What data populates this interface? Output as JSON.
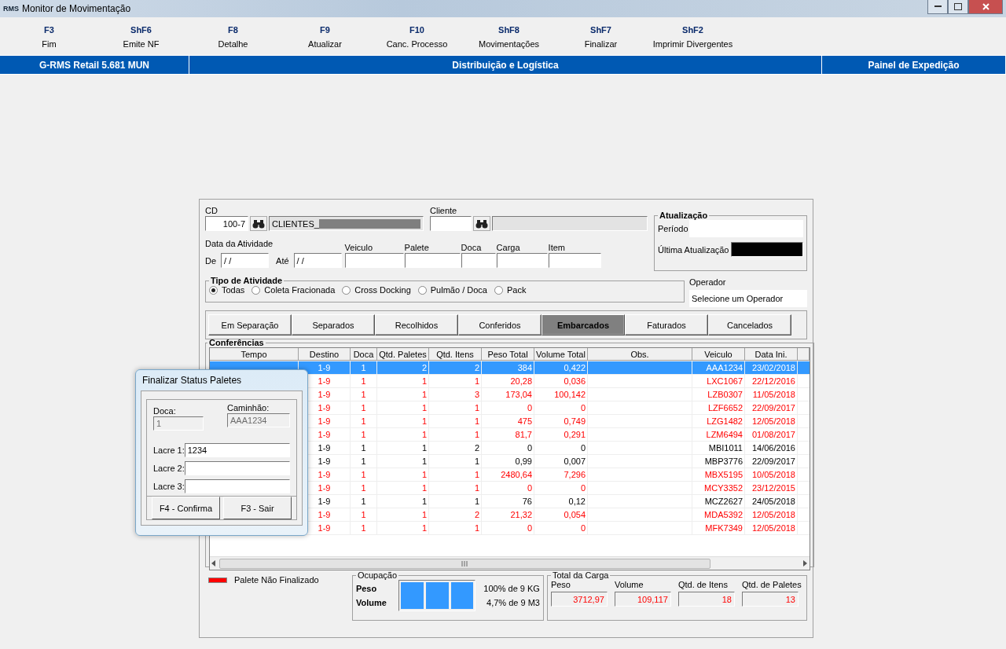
{
  "window": {
    "title": "Monitor de Movimentação",
    "logo": "RMS"
  },
  "function_keys": [
    {
      "key": "F3",
      "label": "Fim"
    },
    {
      "key": "ShF6",
      "label": "Emite NF"
    },
    {
      "key": "F8",
      "label": "Detalhe"
    },
    {
      "key": "F9",
      "label": "Atualizar"
    },
    {
      "key": "F10",
      "label": "Canc. Processo"
    },
    {
      "key": "ShF8",
      "label": "Movimentações"
    },
    {
      "key": "ShF7",
      "label": "Finalizar"
    },
    {
      "key": "ShF2",
      "label": "Imprimir Divergentes"
    }
  ],
  "banner": {
    "left": "G-RMS Retail 5.681 MUN",
    "center": "Distribuição e Logística",
    "right": "Painel de Expedição"
  },
  "filters": {
    "cd": {
      "label": "CD",
      "value": "100-7",
      "description": "CLIENTES_"
    },
    "cliente": {
      "label": "Cliente"
    },
    "data_atividade": {
      "label": "Data da Atividade",
      "from_label": "De",
      "from_value": " / /",
      "to_label": "Até",
      "to_value": " / /"
    },
    "fields": [
      {
        "label": "Veiculo"
      },
      {
        "label": "Palete"
      },
      {
        "label": "Doca"
      },
      {
        "label": "Carga"
      },
      {
        "label": "Item"
      }
    ],
    "atualizacao": {
      "title": "Atualização",
      "period_label": "Período",
      "last_label": "Última Atualização"
    },
    "tipo_atividade": {
      "title": "Tipo de Atividade",
      "options": [
        {
          "label": "Todas",
          "selected": true
        },
        {
          "label": "Coleta Fracionada",
          "selected": false
        },
        {
          "label": "Cross Docking",
          "selected": false
        },
        {
          "label": "Pulmão / Doca",
          "selected": false
        },
        {
          "label": "Pack",
          "selected": false
        }
      ]
    },
    "operador": {
      "label": "Operador",
      "value": "Selecione um Operador"
    }
  },
  "status_tabs": [
    {
      "label": "Em Separação",
      "selected": false
    },
    {
      "label": "Separados",
      "selected": false
    },
    {
      "label": "Recolhidos",
      "selected": false
    },
    {
      "label": "Conferidos",
      "selected": false
    },
    {
      "label": "Embarcados",
      "selected": true
    },
    {
      "label": "Faturados",
      "selected": false
    },
    {
      "label": "Cancelados",
      "selected": false
    }
  ],
  "conferencias": {
    "title": "Conferências",
    "columns": [
      "Tempo",
      "Destino",
      "Doca",
      "Qtd. Paletes",
      "Qtd. Itens",
      "Peso Total",
      "Volume Total",
      "Obs.",
      "Veiculo",
      "Data Ini."
    ],
    "rows": [
      {
        "selected": true,
        "alert": false,
        "cells": [
          "",
          "1-9",
          "1",
          "2",
          "2",
          "384",
          "0,422",
          "",
          "AAA1234",
          "23/02/2018"
        ]
      },
      {
        "selected": false,
        "alert": true,
        "cells": [
          "",
          "1-9",
          "1",
          "1",
          "1",
          "20,28",
          "0,036",
          "",
          "LXC1067",
          "22/12/2016"
        ]
      },
      {
        "selected": false,
        "alert": true,
        "cells": [
          "",
          "1-9",
          "1",
          "1",
          "3",
          "173,04",
          "100,142",
          "",
          "LZB0307",
          "11/05/2018"
        ]
      },
      {
        "selected": false,
        "alert": true,
        "cells": [
          "",
          "1-9",
          "1",
          "1",
          "1",
          "0",
          "0",
          "",
          "LZF6652",
          "22/09/2017"
        ]
      },
      {
        "selected": false,
        "alert": true,
        "cells": [
          "",
          "1-9",
          "1",
          "1",
          "1",
          "475",
          "0,749",
          "",
          "LZG1482",
          "12/05/2018"
        ]
      },
      {
        "selected": false,
        "alert": true,
        "cells": [
          "",
          "1-9",
          "1",
          "1",
          "1",
          "81,7",
          "0,291",
          "",
          "LZM6494",
          "01/08/2017"
        ]
      },
      {
        "selected": false,
        "alert": false,
        "cells": [
          "",
          "1-9",
          "1",
          "1",
          "2",
          "0",
          "0",
          "",
          "MBI1011",
          "14/06/2016"
        ]
      },
      {
        "selected": false,
        "alert": false,
        "cells": [
          "",
          "1-9",
          "1",
          "1",
          "1",
          "0,99",
          "0,007",
          "",
          "MBP3776",
          "22/09/2017"
        ]
      },
      {
        "selected": false,
        "alert": true,
        "cells": [
          "",
          "1-9",
          "1",
          "1",
          "1",
          "2480,64",
          "7,296",
          "",
          "MBX5195",
          "10/05/2018"
        ]
      },
      {
        "selected": false,
        "alert": true,
        "cells": [
          "",
          "1-9",
          "1",
          "1",
          "1",
          "0",
          "0",
          "",
          "MCY3352",
          "23/12/2015"
        ]
      },
      {
        "selected": false,
        "alert": false,
        "cells": [
          "",
          "1-9",
          "1",
          "1",
          "1",
          "76",
          "0,12",
          "",
          "MCZ2627",
          "24/05/2018"
        ]
      },
      {
        "selected": false,
        "alert": true,
        "cells": [
          "",
          "1-9",
          "1",
          "1",
          "2",
          "21,32",
          "0,054",
          "",
          "MDA5392",
          "12/05/2018"
        ]
      },
      {
        "selected": false,
        "alert": true,
        "cells": [
          "",
          "1-9",
          "1",
          "1",
          "1",
          "0",
          "0",
          "",
          "MFK7349",
          "12/05/2018"
        ]
      }
    ]
  },
  "legend": {
    "label": "Palete Não Finalizado",
    "color": "#ff0000"
  },
  "ocupacao": {
    "title": "Ocupação",
    "level": 1,
    "rows": [
      {
        "label": "Peso",
        "reading": "100% de 9 KG"
      },
      {
        "label": "Volume",
        "reading": "4,7% de 9 M3"
      }
    ]
  },
  "total_carga": {
    "title": "Total da Carga",
    "items": [
      {
        "label": "Peso",
        "value": "3712,97"
      },
      {
        "label": "Volume",
        "value": "109,117"
      },
      {
        "label": "Qtd. de Itens",
        "value": "18"
      },
      {
        "label": "Qtd. de Paletes",
        "value": "13"
      }
    ]
  },
  "dialog": {
    "title": "Finalizar Status Paletes",
    "doca": {
      "label": "Doca:",
      "value": "1",
      "disabled": true
    },
    "caminhao": {
      "label": "Caminhão:",
      "value": "AAA1234",
      "disabled": true
    },
    "lacres": [
      {
        "label": "Lacre 1:",
        "value": "1234"
      },
      {
        "label": "Lacre 2:"
      },
      {
        "label": "Lacre 3:"
      }
    ],
    "buttons": [
      "F4 - Confirma",
      "F3 - Sair"
    ]
  }
}
